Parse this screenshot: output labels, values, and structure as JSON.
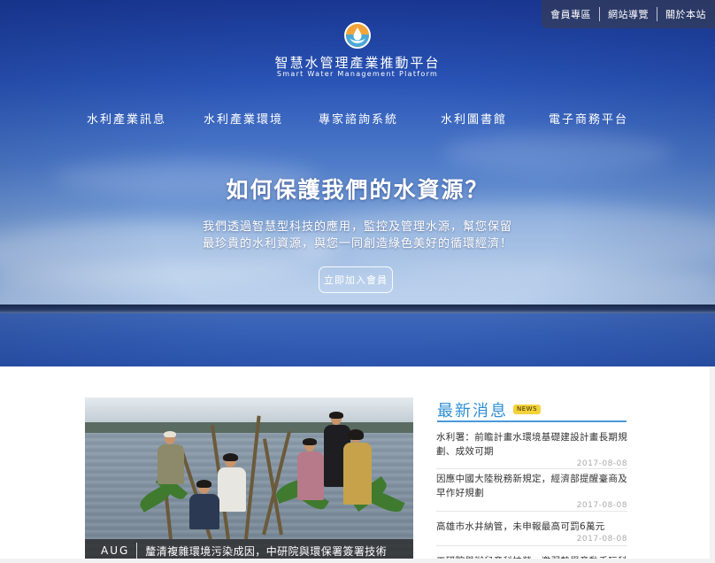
{
  "utility_nav": [
    "會員專區",
    "網站導覽",
    "關於本站"
  ],
  "brand": {
    "name_cn": "智慧水管理產業推動平台",
    "name_en": "Smart Water Management Platform",
    "logo_icon": "water-drop-hands-icon",
    "logo_colors": {
      "outer": "#f2a43a",
      "water": "#4aa8d8"
    }
  },
  "main_nav": [
    "水利產業訊息",
    "水利產業環境",
    "專家諮詢系統",
    "水利圖書館",
    "電子商務平台"
  ],
  "hero": {
    "title": "如何保護我們的水資源？",
    "subtitle_lines": [
      "我們透過智慧型科技的應用，監控及管理水源，幫您保留",
      "最珍貴的水利資源，與您一同創造綠色美好的循環經濟！"
    ],
    "cta_label": "立即加入會員"
  },
  "feature": {
    "month": "AUG",
    "caption": "釐清複雜環境污染成因，中研院與環保署簽署技術"
  },
  "news": {
    "title": "最新消息",
    "badge": "NEWS",
    "accent_color": "#2f8fd4",
    "items": [
      {
        "text": "水利署：前瞻計畫水環境基礎建設計畫長期規劃、成效可期",
        "date": "2017-08-08"
      },
      {
        "text": "因應中國大陸稅務新規定，經濟部提醒臺商及早作好規劃",
        "date": "2017-08-08"
      },
      {
        "text": "高雄市水井納管，未申報最高可罰6萬元",
        "date": "2017-08-08"
      },
      {
        "text": "工研院舉辦兒童科技營，邀弱勢學童動手玩科技",
        "date": ""
      }
    ]
  }
}
